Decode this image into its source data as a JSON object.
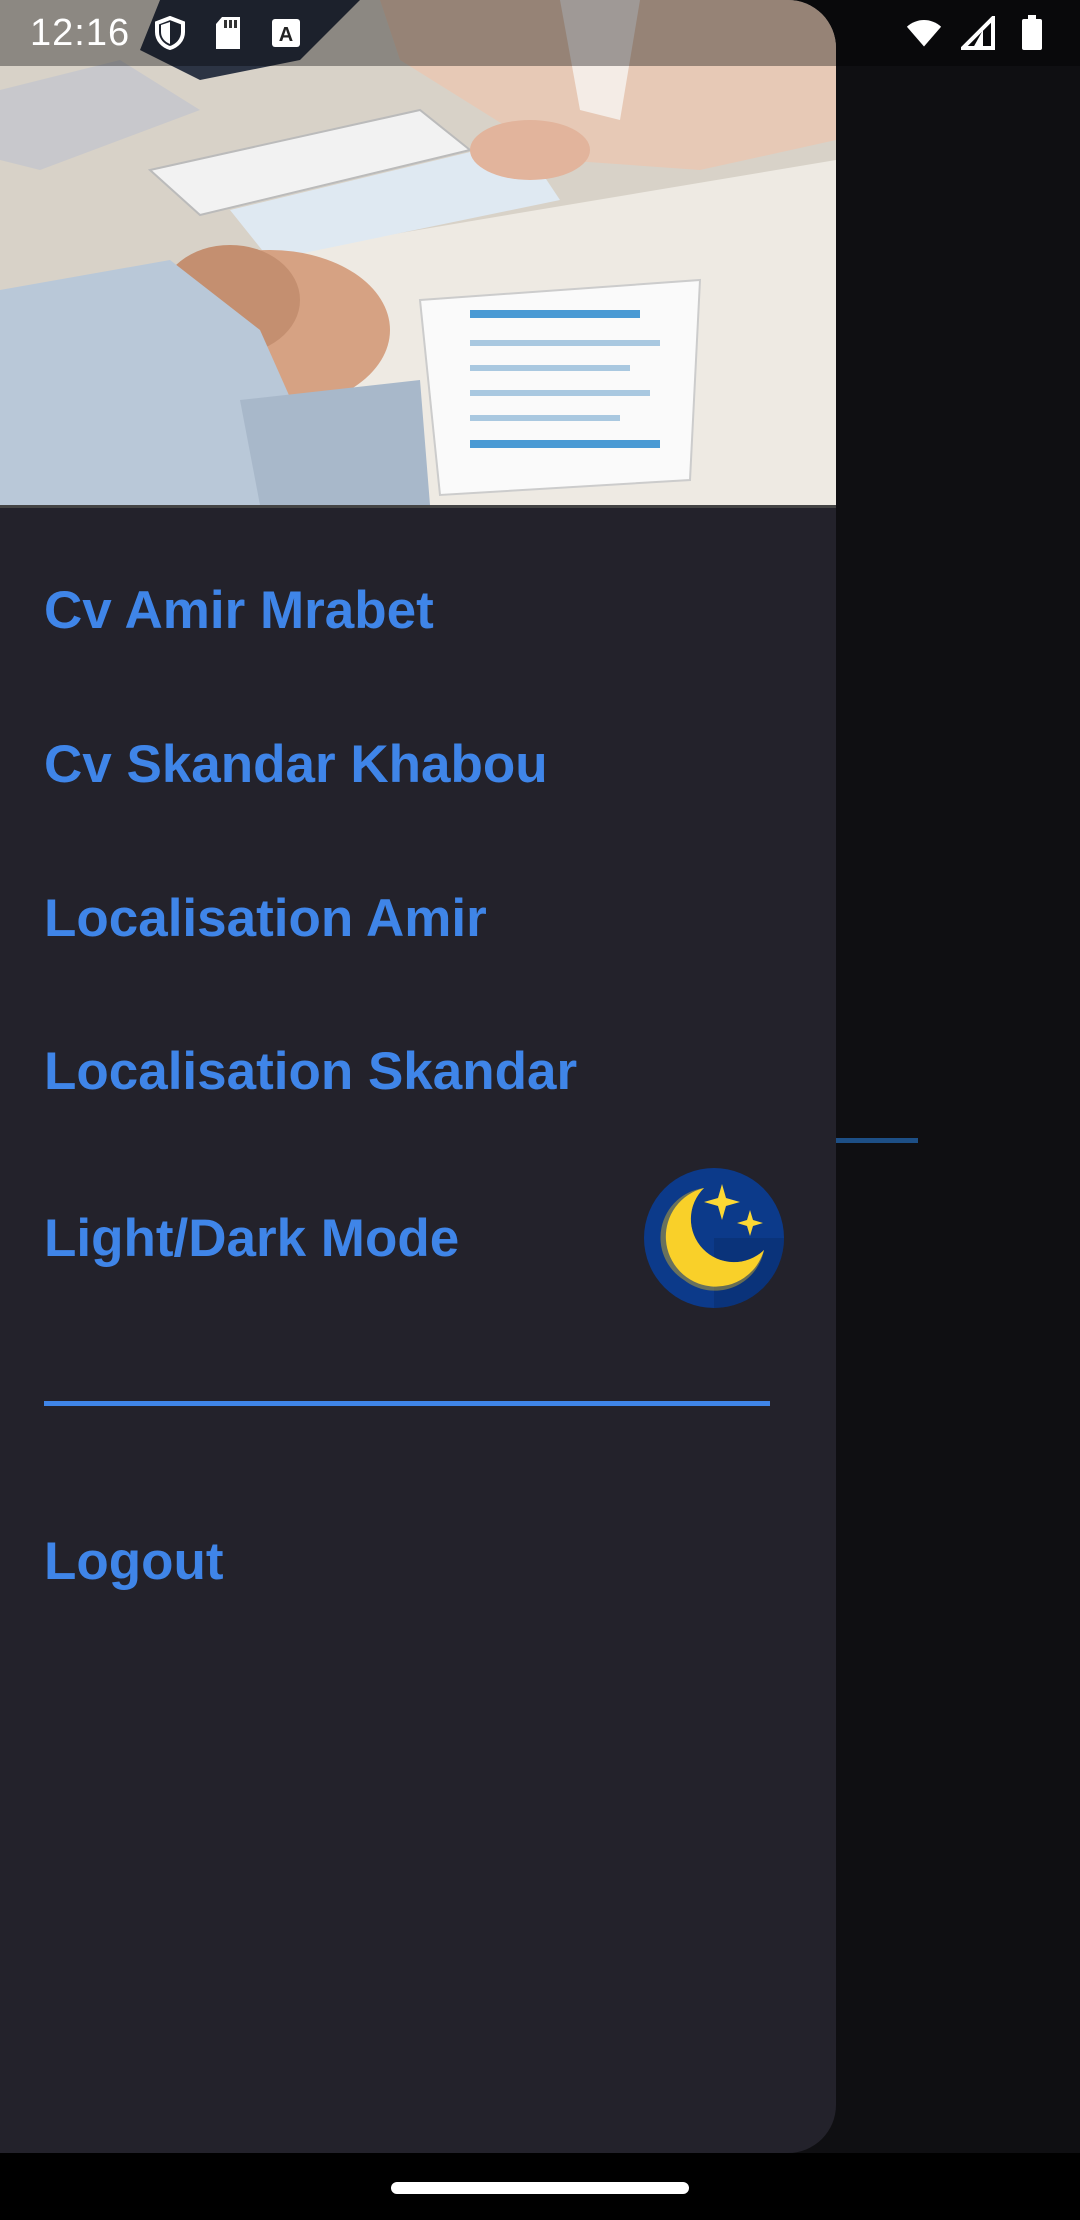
{
  "status_bar": {
    "time": "12:16",
    "left_icons": [
      "shield-icon",
      "sd-card-icon",
      "keyboard-a-icon"
    ],
    "right_icons": [
      "wifi-icon",
      "cell-signal-icon",
      "battery-icon"
    ]
  },
  "drawer": {
    "header_image": "job-interview-photo",
    "menu": {
      "cv_amir": "Cv Amir Mrabet",
      "cv_skandar": "Cv Skandar Khabou",
      "loc_amir": "Localisation Amir",
      "loc_skandar": "Localisation Skandar",
      "mode": "Light/Dark Mode",
      "logout": "Logout"
    },
    "mode_icon": "moon-stars-icon"
  },
  "colors": {
    "accent": "#3f85e8",
    "drawer_bg": "#23222b",
    "app_bg": "#0f0f12",
    "moon_yellow": "#fcd834",
    "moon_circle": "#0c3a8a"
  }
}
